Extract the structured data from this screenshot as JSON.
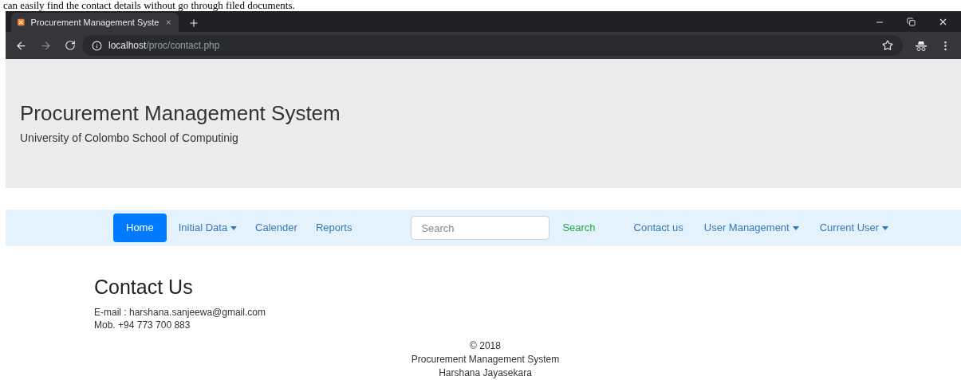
{
  "document_text": "can easily find the contact details without go through filed documents.",
  "browser": {
    "tab_title": "Procurement Management Syste",
    "url_host": "localhost",
    "url_path": "/proc/contact.php"
  },
  "header": {
    "title": "Procurement Management System",
    "subtitle": "University of Colombo School of Computinig"
  },
  "navbar": {
    "left_items": [
      {
        "label": "Home",
        "kind": "link",
        "selected": true
      },
      {
        "label": "Initial Data",
        "kind": "dropdown",
        "selected": false
      },
      {
        "label": "Calender",
        "kind": "link",
        "selected": false
      },
      {
        "label": "Reports",
        "kind": "link",
        "selected": false
      }
    ],
    "search": {
      "placeholder": "Search",
      "button": "Search"
    },
    "right_items": [
      {
        "label": "Contact us",
        "kind": "link",
        "selected": false
      },
      {
        "label": "User Management",
        "kind": "dropdown",
        "selected": false
      },
      {
        "label": "Current User",
        "kind": "dropdown",
        "selected": false
      }
    ]
  },
  "contact": {
    "heading": "Contact Us",
    "lines": [
      "E-mail : harshana.sanjeewa@gmail.com",
      "Mob. +94 773 700 883"
    ]
  },
  "footer": [
    "© 2018",
    "Procurement Management System",
    "Harshana Jayasekara"
  ]
}
